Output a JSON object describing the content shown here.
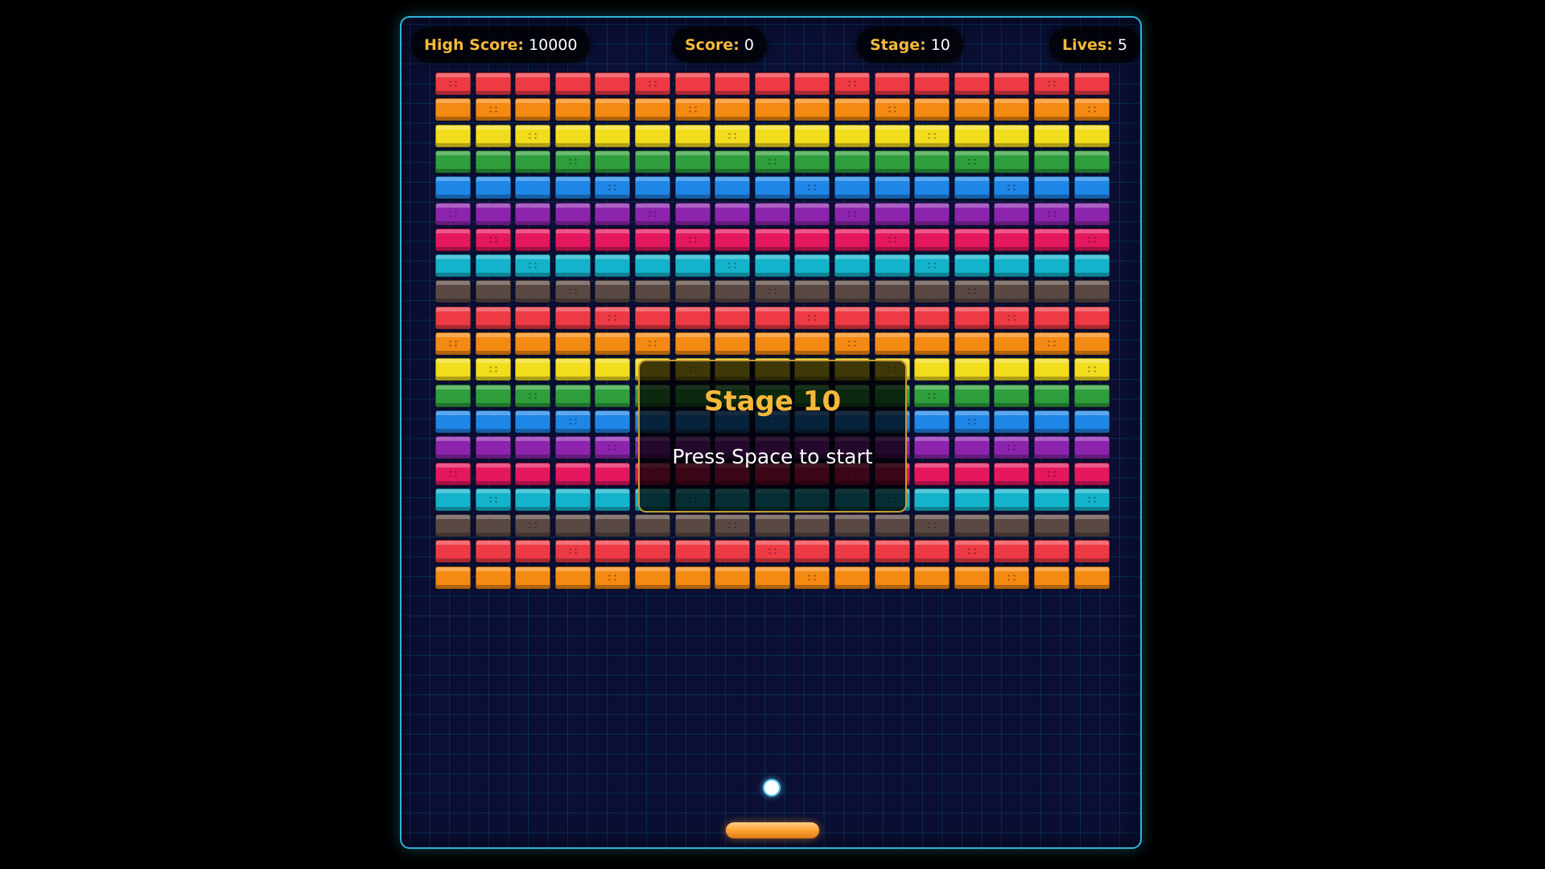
{
  "hud": {
    "high_score_label": "High Score:",
    "high_score_value": "10000",
    "score_label": "Score:",
    "score_value": "0",
    "stage_label": "Stage:",
    "stage_value": "10",
    "lives_label": "Lives:",
    "lives_value": "5"
  },
  "overlay": {
    "title": "Stage 10",
    "hint": "Press Space to start"
  },
  "bricks": {
    "columns": 17,
    "row_colors": [
      "red",
      "orange",
      "yellow",
      "green",
      "blue",
      "purple",
      "pink",
      "cyan",
      "brown",
      "red",
      "orange",
      "yellow",
      "green",
      "blue",
      "purple",
      "pink",
      "cyan",
      "brown",
      "red",
      "orange"
    ]
  },
  "palette": {
    "red": "#ee3a45",
    "orange": "#f58a12",
    "yellow": "#f2dd1c",
    "green": "#2f9e3c",
    "blue": "#1e86e6",
    "purple": "#8d24ad",
    "pink": "#e4175f",
    "cyan": "#14b3cc",
    "brown": "#5a4843",
    "frame_border": "#2fb4d6",
    "hud_label": "#f5b83a",
    "overlay_border": "#c99a2e"
  },
  "icons": {
    "ball": "ball-icon",
    "paddle": "paddle-icon"
  }
}
